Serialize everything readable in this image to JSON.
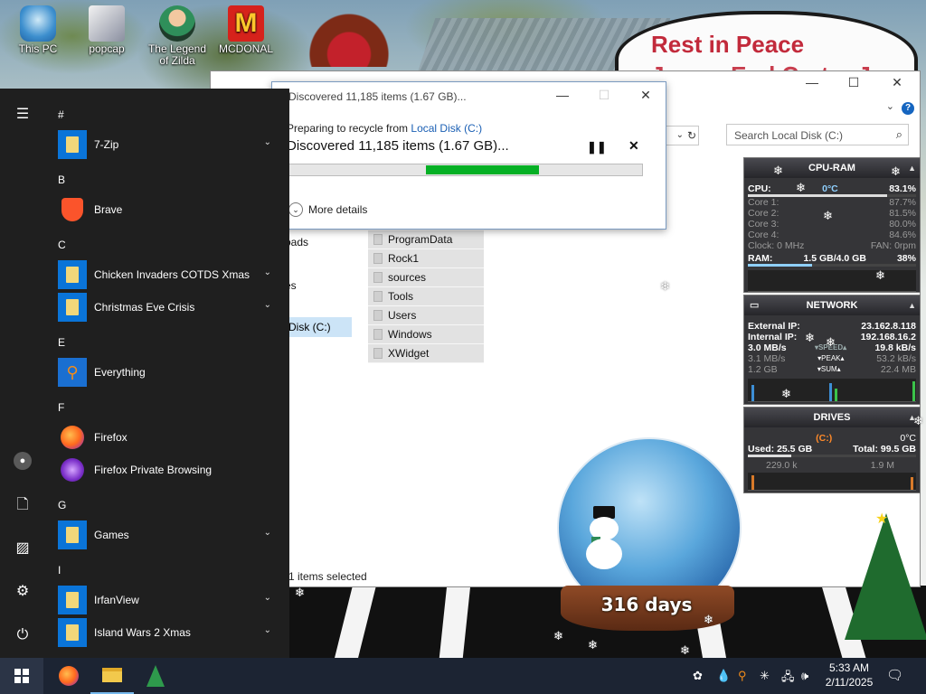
{
  "desktop": {
    "icons": [
      {
        "label": "This PC"
      },
      {
        "label": "popcap"
      },
      {
        "label": "The Legend of Zilda"
      },
      {
        "label": "MCDONAL"
      }
    ],
    "sign_line1": "Rest in Peace",
    "sign_line2": "James Earl Carter Jr"
  },
  "explorer": {
    "search_placeholder": "Search Local Disk (C:)",
    "nav_items": [
      "oads",
      "es",
      "Disk (C:)"
    ],
    "files": [
      "ProgramData",
      "Rock1",
      "sources",
      "Tools",
      "Users",
      "Windows",
      "XWidget"
    ],
    "status": "1 items selected"
  },
  "dialog": {
    "title": "Discovered 11,185 items (1.67 GB)...",
    "sub_prefix": "Preparing to recycle from ",
    "sub_link": "Local Disk (C:)",
    "main": "Discovered 11,185 items (1.67 GB)...",
    "pause_icon": "pause-icon",
    "cancel_icon": "close-icon",
    "more_details": "More details",
    "progress_start": 0.39,
    "progress_end": 0.71,
    "progress_color": "#06b025"
  },
  "cpu_widget": {
    "title": "CPU-RAM",
    "cpu_label": "CPU:",
    "cpu_temp": "0°C",
    "cpu_pct": "83.1%",
    "cores": [
      {
        "label": "Core 1:",
        "value": "87.7%"
      },
      {
        "label": "Core 2:",
        "value": "81.5%"
      },
      {
        "label": "Core 3:",
        "value": "80.0%"
      },
      {
        "label": "Core 4:",
        "value": "84.6%"
      }
    ],
    "clock": "Clock: 0 MHz",
    "fan": "FAN: 0rpm",
    "ram_label": "RAM:",
    "ram_value": "1.5 GB/4.0 GB",
    "ram_pct": "38%"
  },
  "network_widget": {
    "title": "NETWORK",
    "external_label": "External IP:",
    "external_value": "23.162.8.118",
    "internal_label": "Internal IP:",
    "internal_value": "192.168.16.2",
    "speed_left": "3.0 MB/s",
    "speed_label": "SPEED",
    "speed_right": "19.8 kB/s",
    "peak_left": "3.1 MB/s",
    "peak_label": "PEAK",
    "peak_right": "53.2 kB/s",
    "sum_left": "1.2 GB",
    "sum_label": "SUM",
    "sum_right": "22.4 MB"
  },
  "drives_widget": {
    "title": "DRIVES",
    "drive": "(C:)",
    "temp": "0°C",
    "used": "Used: 25.5 GB",
    "total": "Total: 99.5 GB",
    "read": "229.0 k",
    "write": "1.9 M"
  },
  "globe": {
    "label": "316 days"
  },
  "startmenu": {
    "groups": [
      {
        "letter": "#",
        "items": [
          {
            "label": "7-Zip",
            "type": "folder",
            "expand": true
          }
        ]
      },
      {
        "letter": "B",
        "items": [
          {
            "label": "Brave",
            "type": "app",
            "icon": "brave-icon"
          }
        ]
      },
      {
        "letter": "C",
        "items": [
          {
            "label": "Chicken Invaders COTDS Xmas",
            "type": "folder",
            "expand": true
          },
          {
            "label": "Christmas Eve Crisis",
            "type": "folder",
            "expand": true
          }
        ]
      },
      {
        "letter": "E",
        "items": [
          {
            "label": "Everything",
            "type": "app",
            "icon": "everything-icon"
          }
        ]
      },
      {
        "letter": "F",
        "items": [
          {
            "label": "Firefox",
            "type": "app",
            "icon": "firefox-icon"
          },
          {
            "label": "Firefox Private Browsing",
            "type": "app",
            "icon": "firefox-private-icon"
          }
        ]
      },
      {
        "letter": "G",
        "items": [
          {
            "label": "Games",
            "type": "folder",
            "expand": true
          }
        ]
      },
      {
        "letter": "I",
        "items": [
          {
            "label": "IrfanView",
            "type": "folder",
            "expand": true
          },
          {
            "label": "Island Wars 2 Xmas",
            "type": "folder",
            "expand": true
          }
        ]
      }
    ]
  },
  "taskbar": {
    "time": "5:33 AM",
    "date": "2/11/2025"
  }
}
